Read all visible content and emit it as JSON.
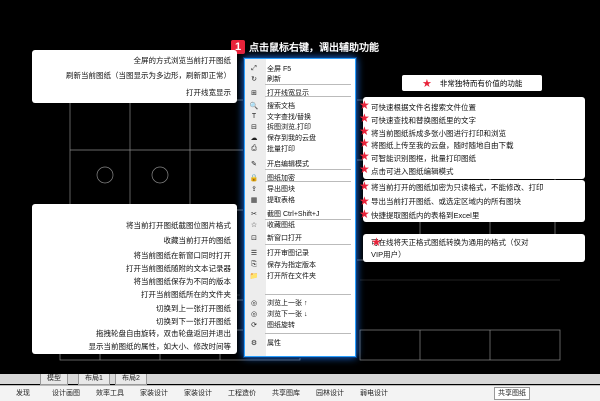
{
  "title": {
    "number": "1",
    "text": "点击鼠标右键，调出辅助功能"
  },
  "legend": {
    "star": "★",
    "text": "非常独特而有价值的功能"
  },
  "menu": {
    "items": [
      {
        "icon": "⤢",
        "label": "全屏 F5",
        "name": "fullscreen"
      },
      {
        "icon": "↻",
        "label": "刷新",
        "name": "refresh"
      },
      {
        "icon": "⊞",
        "label": "打开线宽显示",
        "name": "toggle-lineweight"
      },
      {
        "icon": "🔍",
        "label": "搜索文档",
        "name": "search-docs"
      },
      {
        "icon": "T",
        "label": "文字查找/替换",
        "name": "text-find-replace"
      },
      {
        "icon": "⊟",
        "label": "拆图浏览,打印",
        "name": "split-view-print"
      },
      {
        "icon": "☁",
        "label": "保存到我的云盘",
        "name": "save-to-cloud"
      },
      {
        "icon": "⎙",
        "label": "批量打印",
        "name": "batch-print"
      },
      {
        "icon": "✎",
        "label": "开启编辑模式",
        "name": "edit-mode"
      },
      {
        "icon": "🔒",
        "label": "图纸加密",
        "name": "encrypt-drawing"
      },
      {
        "icon": "⇪",
        "label": "导出图块",
        "name": "export-blocks"
      },
      {
        "icon": "▦",
        "label": "提取表格",
        "name": "extract-table"
      },
      {
        "icon": "✂",
        "label": "截图 Ctrl+Shift+J",
        "name": "screenshot"
      },
      {
        "icon": "☆",
        "label": "收藏图纸",
        "name": "favorite-drawing"
      },
      {
        "icon": "⊡",
        "label": "新窗口打开",
        "name": "open-new-window"
      },
      {
        "icon": "☰",
        "label": "打开审图记录",
        "name": "open-review-log"
      },
      {
        "icon": "⎘",
        "label": "保存为指定版本",
        "name": "save-as-version"
      },
      {
        "icon": "📁",
        "label": "打开所在文件夹",
        "name": "open-folder"
      },
      {
        "icon": "◎",
        "label": "浏览上一张 ↑",
        "name": "browse-previous"
      },
      {
        "icon": "◎",
        "label": "浏览下一张 ↓",
        "name": "browse-next"
      },
      {
        "icon": "⟳",
        "label": "图纸旋转",
        "name": "rotate-drawing"
      },
      {
        "icon": "⚙",
        "label": "属性",
        "name": "properties"
      }
    ]
  },
  "left_group_1": [
    "全屏的方式浏览当前打开图纸",
    "刷新当前图纸（当图显示为多边形，刷新即正常）",
    "打开线宽显示"
  ],
  "left_group_2": [
    "将当前打开图纸截图位图片格式",
    "收藏当前打开的图纸",
    "将当前图纸在新窗口同时打开",
    "打开当前图纸随附的文本记录器",
    "将当前图纸保存为不同的版本",
    "打开当前图纸所在的文件夹",
    "切换到上一张打开图纸",
    "切换到下一张打开图纸",
    "拖拽轮盘自由旋转，双击轮盘返回并退出",
    "显示当前图纸的属性，如大小、修改时间等"
  ],
  "right_group_1": [
    "可快速根据文件名搜索文件位置",
    "可快速查找和替换图纸里的文字",
    "将当前图纸拆成多张小图进行打印和浏览",
    "将图纸上传至我的云盘，随时随地自由下载",
    "可智能识别图框，批量打印图纸",
    "点击可进入图纸编辑模式"
  ],
  "right_group_2": [
    "将当前打开的图纸加密为只读格式，不能修改、打印",
    "导出当前打开图纸、或选定区域内的所有图块",
    "快捷提取图纸内的表格到Excel里"
  ],
  "right_group_3": [
    "可在线将天正格式图纸转换为通用的格式（仅对",
    "VIP用户）"
  ],
  "layout_tabs": [
    "模型",
    "布局1",
    "布局2"
  ],
  "bottom_toolbar": [
    "发现",
    "设计画图",
    "效率工具",
    "家装设计",
    "家装设计",
    "工程造价",
    "共享图库",
    "园林设计",
    "弱电设计",
    "共享图纸"
  ],
  "colors": {
    "accent": "#e8233a",
    "menu_border": "#2aa0ff",
    "cad_line": "#9a9a9a"
  }
}
